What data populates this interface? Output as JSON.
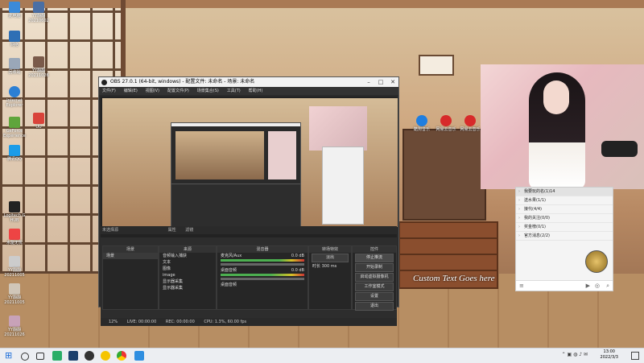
{
  "desktop_icons": [
    {
      "label": "此电脑"
    },
    {
      "label": "YY翻翻 20210602",
      "color": "#4a6fa5"
    },
    {
      "label": "网络"
    },
    {
      "label": "YY翻翻 20211026",
      "color": "#7a5a4a"
    },
    {
      "label": "回收站"
    },
    {
      "label": "Internet Explorer"
    },
    {
      "label": "GeForce Experience"
    },
    {
      "label": "腾讯QQ"
    },
    {
      "label": "Logitech G HUB"
    },
    {
      "label": "UU"
    },
    {
      "label": "水能无忧"
    },
    {
      "label": "YY翻翻 20211005"
    },
    {
      "label": "YY翻翻 20211005"
    },
    {
      "label": "YY翻翻 20211026"
    }
  ],
  "desktop_right_icons": [
    {
      "label": "酷狗音乐"
    },
    {
      "label": "网易云音乐"
    },
    {
      "label": "网易云音乐"
    }
  ],
  "obs": {
    "title": "OBS 27.0.1 (64-bit, windows) - 配置文件: 未命名 - 场景: 未命名",
    "menu": [
      "文件(F)",
      "编辑(E)",
      "视图(V)",
      "配置文件(P)",
      "场景集合(S)",
      "工具(T)",
      "帮助(H)"
    ],
    "source_bar": "未选择源",
    "source_bar_buttons": [
      "属性",
      "滤镜"
    ],
    "dock_scenes": {
      "title": "场景",
      "items": [
        "场景"
      ]
    },
    "dock_sources": {
      "title": "来源",
      "items": [
        "音频输入捕获",
        "文本",
        "图像",
        "image",
        "显示器采集",
        "显示器采集"
      ]
    },
    "dock_mixer": {
      "title": "混音器",
      "channels": [
        {
          "name": "麦克风/Aux",
          "db": "0.0 dB"
        },
        {
          "name": "桌面音频",
          "db": "0.0 dB"
        },
        {
          "name": "桌面音频",
          "db": ""
        }
      ]
    },
    "dock_transitions": {
      "title": "转场特效",
      "type": "淡出",
      "duration_label": "时长",
      "duration": "300 ms"
    },
    "dock_controls": {
      "title": "控件",
      "buttons": [
        "停止推流",
        "开始录制",
        "启动虚拟摄像机",
        "工作室模式",
        "设置",
        "退出"
      ]
    },
    "status": {
      "live": "LIVE: 00:00:00",
      "rec": "REC: 00:00:00",
      "cpu": "CPU: 1.3%, 60.00 fps",
      "drop": "12%"
    }
  },
  "custom_text": "Custom Text Goes here",
  "chat": {
    "items": [
      "我要玩的名(1)14",
      "送水果(1/1)",
      "接代(4/4)",
      "我的关注(0/0)",
      "奖金榜(0/1)",
      "官方消息(2/2)"
    ]
  },
  "clock": {
    "time": "13:00",
    "date": "2022/3/3"
  },
  "colors": {
    "taskbar": "#eceef2",
    "obs_bg": "#2b2b2b",
    "chat_bg": "#f4f4f4"
  }
}
